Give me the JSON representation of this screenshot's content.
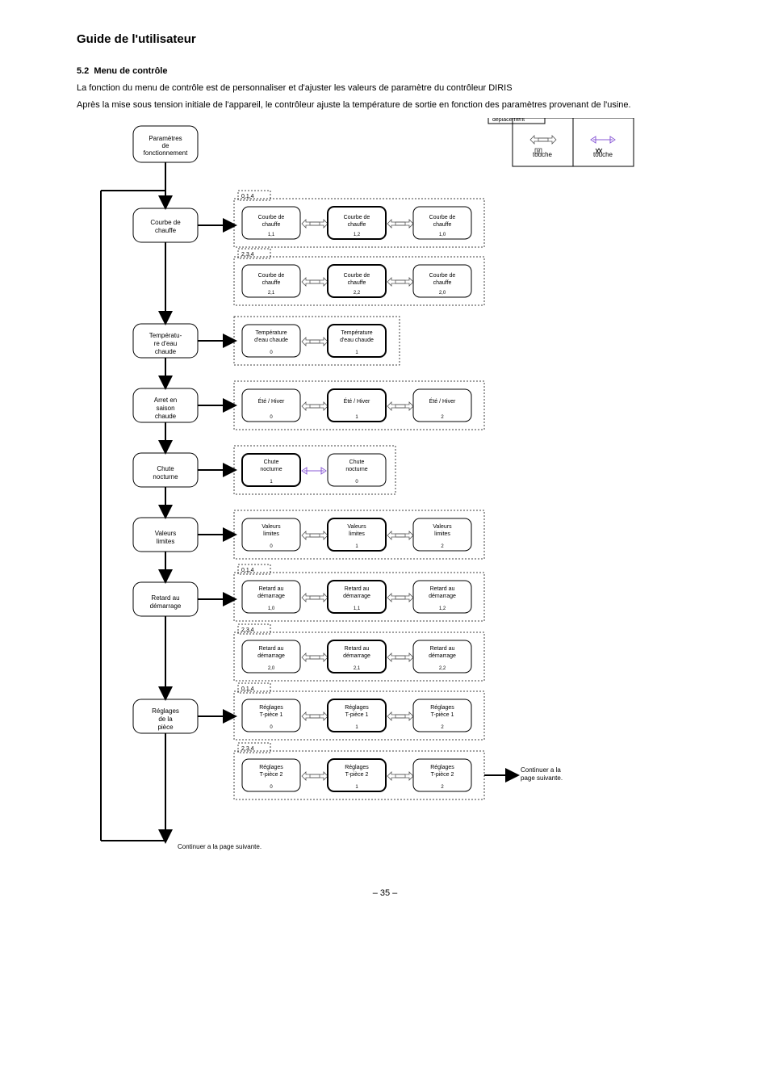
{
  "header": {
    "title": "Guide de l'utilisateur"
  },
  "section": {
    "num": "5.2",
    "title": "Menu de contrôle",
    "p1": "La fonction du menu de contrôle est de personnaliser et d'ajuster les valeurs de paramètre du contrôleur DIRIS",
    "p2": "Après la mise sous tension initiale de l'appareil, le contrôleur ajuste la température de sortie en fonction des paramètres provenant de l'usine."
  },
  "legend": {
    "title": "Touche de déplacement",
    "left": "touche",
    "right": "touche"
  },
  "flow": {
    "start": "Paramètres de fonctionnement",
    "steps": [
      {
        "main": "Courbe de chauffe",
        "groups": [
          {
            "tab": "0,1,4",
            "nodes": [
              "Courbe de chauffe1,1",
              "Courbe de chauffe1,2",
              "Courbe de chauffe1,0"
            ]
          },
          {
            "tab": "2,3,4",
            "nodes": [
              "Courbe de chauffe2,1",
              "Courbe de chauffe2,2",
              "Courbe de chauffe2,0"
            ]
          }
        ]
      },
      {
        "main": "Températu-re d'eau chaude",
        "groups": [
          {
            "nodes": [
              "Température d'eau chaude0",
              "Température d'eau chaude1"
            ]
          }
        ]
      },
      {
        "main": "Arret en saison chaude",
        "groups": [
          {
            "nodes": [
              "Été / Hiver0",
              "Été / Hiver1",
              "Été / Hiver2"
            ]
          }
        ]
      },
      {
        "main": "Chute nocturne",
        "groups": [
          {
            "nodes": [
              "Chute nocturne1",
              "Chute nocturne0"
            ]
          }
        ]
      },
      {
        "main": "Valeurs limites",
        "groups": [
          {
            "nodes": [
              "Valeurs limites0",
              "Valeurs limites1",
              "Valeurs limites2"
            ]
          }
        ]
      },
      {
        "main": "Retard au démarrage",
        "groups": [
          {
            "tab": "0,1,4",
            "nodes": [
              "Retard au démarrage1,0",
              "Retard au démarrage1,1",
              "Retard au démarrage1,2"
            ]
          },
          {
            "tab": "2,3,4",
            "nodes": [
              "Retard au démarrage2,0",
              "Retard au démarrage2,1",
              "Retard au démarrage2,2"
            ]
          }
        ]
      },
      {
        "main": "Réglages  de  la  pièce",
        "groups": [
          {
            "tab": "0,1,4",
            "nodes": [
              "Réglages  T-pièce 10",
              "Réglages  T-pièce 11",
              "Réglages  T-pièce 12"
            ]
          },
          {
            "tab": "2,3,4",
            "nodes": [
              "Réglages  T-pièce 20",
              "Réglages  T-pièce 21",
              "Réglages  T-pièce 22"
            ]
          }
        ]
      }
    ],
    "arrowRight": "Continuer a la page suivante.",
    "arrowDown": "Continuer a la page suivante."
  },
  "footer": "– 35 –"
}
